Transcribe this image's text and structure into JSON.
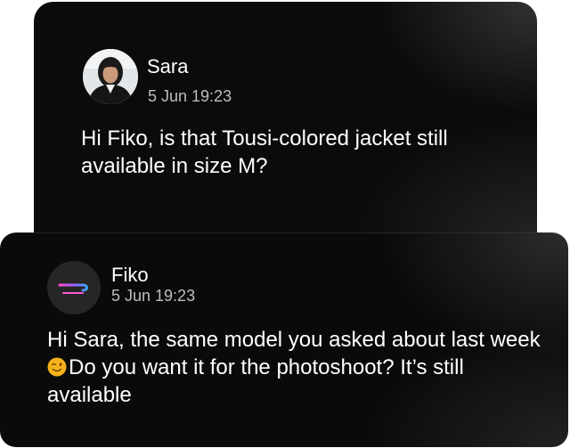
{
  "messages": [
    {
      "sender": "Sara",
      "timestamp": "5 Jun 19:23",
      "text": "Hi Fiko, is that Tousi-colored jacket still available in size M?",
      "avatar": "user-photo-avatar"
    },
    {
      "sender": "Fiko",
      "timestamp": "5 Jun 19:23",
      "text_before_emoji": "Hi Sara, the same model you asked about last week ",
      "emoji": "winking-face-icon",
      "text_after_emoji": "Do you want it for the photoshoot? It’s still available",
      "avatar": "brand-logo-avatar"
    }
  ],
  "colors": {
    "card_background": "#0b0b0b",
    "text_primary": "#ffffff",
    "text_secondary": "#bdbdbd",
    "emoji_yellow": "#f5b21b"
  }
}
